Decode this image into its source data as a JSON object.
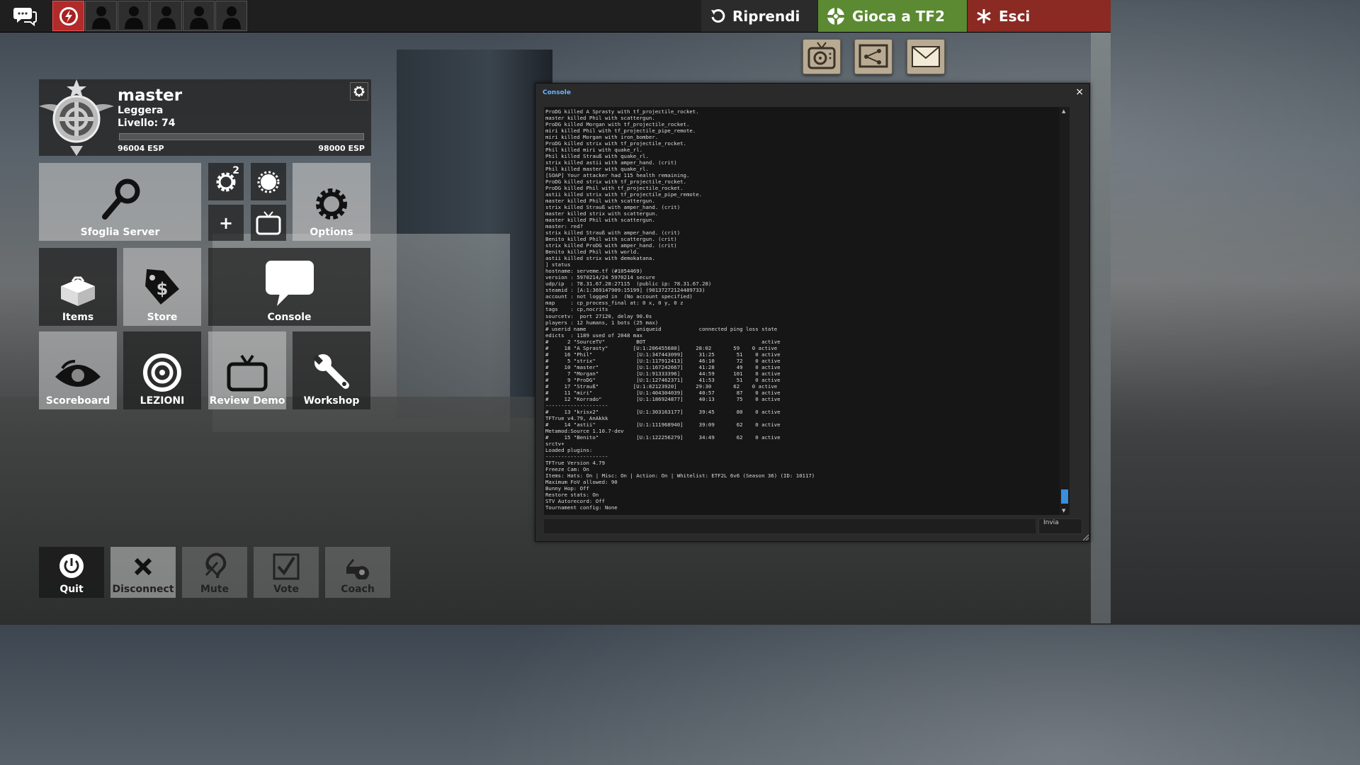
{
  "topbar": {
    "resume_label": "Riprendi",
    "play_label": "Gioca a TF2",
    "quit_label": "Esci"
  },
  "profile": {
    "name": "master",
    "class": "Leggera",
    "level": "Livello: 74",
    "xp_current": "96004 ESP",
    "xp_next": "98000 ESP",
    "xp_fraction": 0.0
  },
  "menu": {
    "server_browser": "Sfoglia Server",
    "options": "Options",
    "items": "Items",
    "store": "Store",
    "console": "Console",
    "scoreboard": "Scoreboard",
    "training": "LEZIONI",
    "review_demo": "Review Demo",
    "workshop": "Workshop",
    "settings_badge": "2",
    "create_server": "+"
  },
  "console": {
    "title": "Console",
    "close": "×",
    "submit_label": "Invia",
    "input_value": "",
    "output": "ProDG killed A Sprasty with tf_projectile_rocket.\nmaster killed Phil with scattergun.\nProDG killed Morgan with tf_projectile_rocket.\nmiri killed Phil with tf_projectile_pipe_remote.\nmiri killed Morgan with iron_bomber.\nProDG killed strix with tf_projectile_rocket.\nPhil killed miri with quake_rl.\nPhil killed Strauß with quake_rl.\nstrix killed astii with amper_hand. (crit)\nPhil killed master with quake_rl.\n[SOAP] Your attacker had 115 health remaining.\nProDG killed strix with tf_projectile_rocket.\nProDG killed Phil with tf_projectile_rocket.\nastii killed strix with tf_projectile_pipe_remote.\nmaster killed Phil with scattergun.\nstrix killed Strauß with amper_hand. (crit)\nmaster killed strix with scattergun.\nmaster killed Phil with scattergun.\nmaster: red?\nstrix killed Strauß with amper_hand. (crit)\nBenito killed Phil with scattergun. (crit)\nstrix killed ProDG with amper_hand. (crit)\nBenito killed Phil with world.\nastii killed strix with demokatana.\n] status\nhostname: serveme.tf (#1054469)\nversion : 5970214/24 5970214 secure\nudp/ip  : 78.31.67.28:27115  (public ip: 78.31.67.28)\nsteamid : [A:1:369147909:15199] (90137272124489733)\naccount : not logged in  (No account specified)\nmap     : cp_process_final at: 0 x, 0 y, 0 z\ntags    : cp,nocrits\nsourcetv:  port 27120, delay 90.0s\nplayers : 12 humans, 1 bots (25 max)\n# userid name                uniqueid            connected ping loss state\nedicts  : 1189 used of 2048 max\n#      2 \"SourceTV\"          BOT                                     active\n#     18 \"A Sprasty\"        [U:1:206455680]     28:02       59    0 active\n#     16 \"Phil\"              [U:1:347443099]     31:25       51    0 active\n#      5 \"strix\"             [U:1:117912413]     46:10       72    0 active\n#     10 \"master\"            [U:1:167242667]     41:28       49    0 active\n#      7 \"Morgan\"            [U:1:91333396]      44:59      101    0 active\n#      9 \"ProDG\"             [U:1:127462371]     41:53       51    0 active\n#     17 \"Strauß\"           [U:1:82123920]      29:30       62    0 active\n#     11 \"miri\"              [U:1:404304039]     40:57       87    0 active\n#     12 \"Korrado\"           [U:1:186924877]     40:13       75    0 active\n--------------------\n#     13 \"krisx2\"            [U:1:303163177]     39:45       80    0 active\nTFTrue v4.79, AnAkkk\n#     14 \"astii\"             [U:1:111968940]     39:09       62    0 active\nMetamod:Source 1.10.7-dev\n#     15 \"Benito\"            [U:1:122256279]     34:49       62    0 active\nsrctv+\nLoaded plugins:\n--------------------\nTFTrue Version 4.79\nFreeze Cam: On\nItems: Hats: On | Misc: On | Action: On | Whitelist: ETF2L 6v6 (Season 36) (ID: 10117)\nMaximum FoV allowed: 90\nBunny Hop: Off\nRestore stats: On\nSTV Autorecord: Off\nTournament config: None"
  },
  "bottom": {
    "quit": "Quit",
    "disconnect": "Disconnect",
    "mute": "Mute",
    "vote": "Vote",
    "coach": "Coach"
  },
  "colors": {
    "resume_bg": "#2b2b2b",
    "play_bg": "#5b8a32",
    "quit_bg": "#8a2a22",
    "console_title": "#6ab4ff",
    "party_self": "#b22a2a"
  },
  "icons": {
    "chat": "chat-bubbles-icon",
    "resume": "resume-arrow-icon",
    "play": "tf2-logo-icon",
    "quit": "asterisk-icon",
    "notifications": [
      "tv-icon",
      "network-icon",
      "mail-icon"
    ]
  }
}
